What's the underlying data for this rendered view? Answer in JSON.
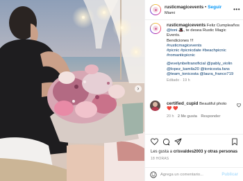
{
  "post": {
    "header": {
      "username": "rusticmagicevents",
      "follow_label": "Seguir",
      "location": "Miami",
      "dot": "•",
      "more_icon": "•••"
    },
    "caption": {
      "username": "rusticmagicevents",
      "text_1": "Feliz Cumpleaños",
      "text_2_mention": "@toni",
      "text_2_emoji": "🎩",
      "text_2_rest": ", te desea Rustic Magic",
      "text_3": "Events.",
      "text_4": "Bendiciones !!!",
      "hashtags": [
        "#rusticmagicevents",
        "#picnic #picnicdate #beachpicnic",
        "#romanticpicnic"
      ],
      "mentions": [
        "@evelynbeltranoficial @pably_violin",
        "@lopez_kamila20 @tonicosta.fans",
        "@team_tonicosta @laura_franco719"
      ],
      "edited": "Editado · 19 h"
    },
    "comment": {
      "username": "certified_cupid",
      "text": "Beautiful photo",
      "emoji": "❤️ ❤️",
      "time": "20 h",
      "likes": "2 Me gusta",
      "reply": "Responder"
    },
    "likes": {
      "prefix": "Les gusta a",
      "user": "crisvaldes2003",
      "suffix": "y otras personas"
    },
    "date": "18 HORAS",
    "add_comment": {
      "placeholder": "Agrega un comentario...",
      "publish": "Publicar"
    }
  }
}
